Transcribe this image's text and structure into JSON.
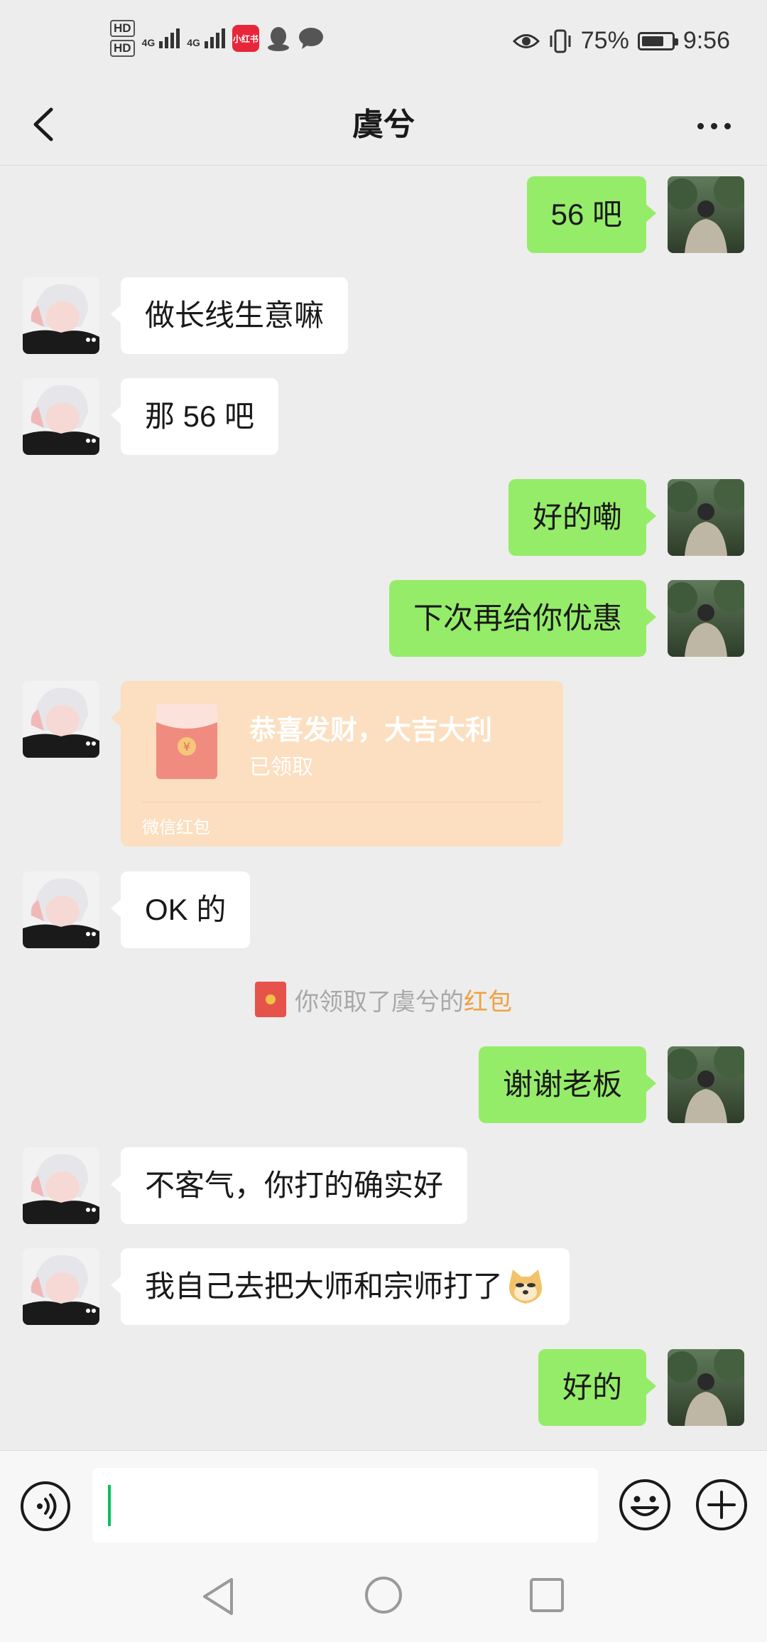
{
  "status_bar": {
    "hd1": "HD",
    "hd2": "HD",
    "net1": "4G",
    "net2": "4G",
    "app_badge": "小红书",
    "battery": "75%",
    "battery_level": 0.75,
    "time": "9:56"
  },
  "header": {
    "title": "虞兮"
  },
  "messages": [
    {
      "side": "right",
      "text": "56 吧"
    },
    {
      "side": "left",
      "text": "做长线生意嘛"
    },
    {
      "side": "left",
      "text": "那 56 吧"
    },
    {
      "side": "right",
      "text": "好的嘞"
    },
    {
      "side": "right",
      "text": "下次再给你优惠"
    },
    {
      "side": "left",
      "type": "red_packet",
      "title": "恭喜发财，大吉大利",
      "status": "已领取",
      "footer": "微信红包"
    },
    {
      "side": "left",
      "text": "OK 的"
    },
    {
      "side": "right",
      "text": "谢谢老板"
    },
    {
      "side": "left",
      "text": "不客气，你打的确实好"
    },
    {
      "side": "left",
      "text": "我自己去把大师和宗师打了"
    },
    {
      "side": "right",
      "text": "好的"
    }
  ],
  "system_message": {
    "prefix": "你领取了虞兮的",
    "highlight": "红包"
  },
  "icons": [
    "back-icon",
    "more-icon",
    "voice-icon",
    "emoji-icon",
    "plus-icon",
    "nav-back-icon",
    "nav-home-icon",
    "nav-recent-icon"
  ],
  "colors": {
    "bubble_mine": "#95ec69",
    "bubble_theirs": "#ffffff",
    "background": "#ededed",
    "red_packet": "#fbdfc0",
    "highlight": "#f0a040"
  }
}
